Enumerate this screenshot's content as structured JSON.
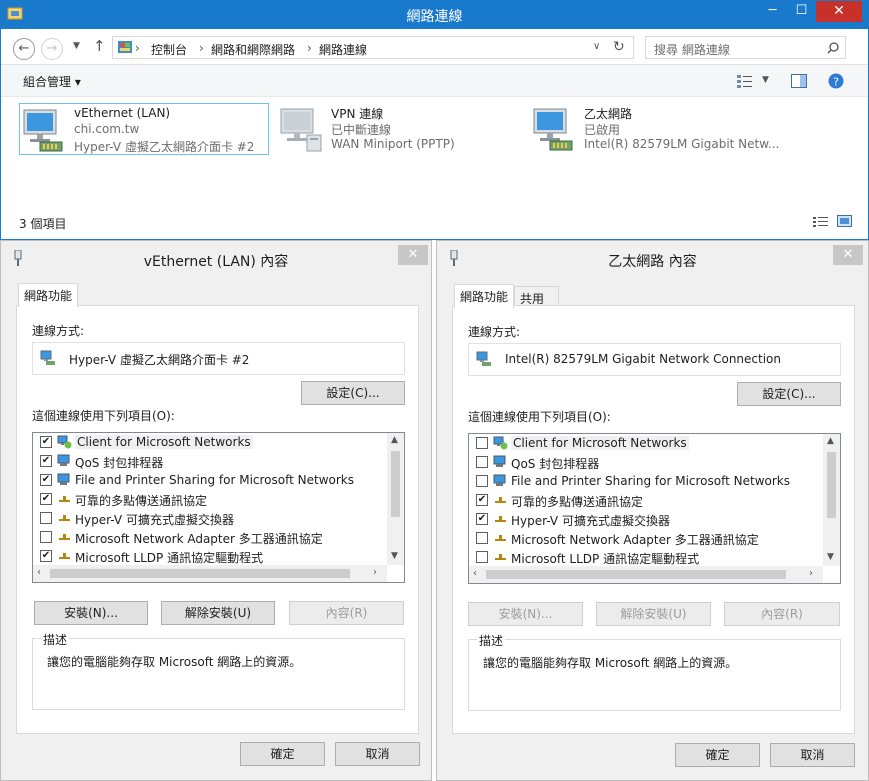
{
  "explorer": {
    "title": "網路連線",
    "window_buttons": {
      "minimize": "─",
      "maximize": "☐",
      "close": "✕"
    },
    "breadcrumb": [
      "控制台",
      "網路和網際網路",
      "網路連線"
    ],
    "search_placeholder": "搜尋 網路連線",
    "command_organize": "組合管理 ▾",
    "items": [
      {
        "name": "vEthernet (LAN)",
        "line2": "chi.com.tw",
        "line3": "Hyper-V 虛擬乙太網路介面卡 #2"
      },
      {
        "name": "VPN 連線",
        "line2": "已中斷連線",
        "line3": "WAN Miniport (PPTP)"
      },
      {
        "name": "乙太網路",
        "line2": "已啟用",
        "line3": "Intel(R) 82579LM Gigabit Netw..."
      }
    ],
    "status": "3 個項目"
  },
  "dialog_left": {
    "title": "vEthernet (LAN) 內容",
    "tabs": [
      "網路功能"
    ],
    "connect_using_label": "連線方式:",
    "adapter": "Hyper-V 虛擬乙太網路介面卡 #2",
    "configure_button": "設定(C)...",
    "items_label": "這個連線使用下列項目(O):",
    "items": [
      {
        "label": "Client for Microsoft Networks",
        "checked": "✔"
      },
      {
        "label": "QoS 封包排程器",
        "checked": "✔"
      },
      {
        "label": "File and Printer Sharing for Microsoft Networks",
        "checked": "✔"
      },
      {
        "label": "可靠的多點傳送通訊協定",
        "checked": "✔"
      },
      {
        "label": "Hyper-V 可擴充式虛擬交換器",
        "checked": ""
      },
      {
        "label": "Microsoft Network Adapter 多工器通訊協定",
        "checked": ""
      },
      {
        "label": "Microsoft LLDP 通訊協定驅動程式",
        "checked": "✔"
      }
    ],
    "install_button": "安裝(N)...",
    "uninstall_button": "解除安裝(U)",
    "properties_button": "內容(R)",
    "description_label": "描述",
    "description": "讓您的電腦能夠存取 Microsoft 網路上的資源。",
    "ok_button": "確定",
    "cancel_button": "取消"
  },
  "dialog_right": {
    "title": "乙太網路 內容",
    "tabs": [
      "網路功能",
      "共用"
    ],
    "connect_using_label": "連線方式:",
    "adapter": "Intel(R) 82579LM Gigabit Network Connection",
    "configure_button": "設定(C)...",
    "items_label": "這個連線使用下列項目(O):",
    "items": [
      {
        "label": "Client for Microsoft Networks",
        "checked": ""
      },
      {
        "label": "QoS 封包排程器",
        "checked": ""
      },
      {
        "label": "File and Printer Sharing for Microsoft Networks",
        "checked": ""
      },
      {
        "label": "可靠的多點傳送通訊協定",
        "checked": "✔"
      },
      {
        "label": "Hyper-V 可擴充式虛擬交換器",
        "checked": "✔"
      },
      {
        "label": "Microsoft Network Adapter 多工器通訊協定",
        "checked": ""
      },
      {
        "label": "Microsoft LLDP 通訊協定驅動程式",
        "checked": ""
      }
    ],
    "install_button": "安裝(N)...",
    "uninstall_button": "解除安裝(U)",
    "properties_button": "內容(R)",
    "description_label": "描述",
    "description": "讓您的電腦能夠存取 Microsoft 網路上的資源。",
    "ok_button": "確定",
    "cancel_button": "取消"
  },
  "colors": {
    "accent": "#1979ca",
    "close": "#c7312a",
    "selection": "#6fc3e8"
  }
}
